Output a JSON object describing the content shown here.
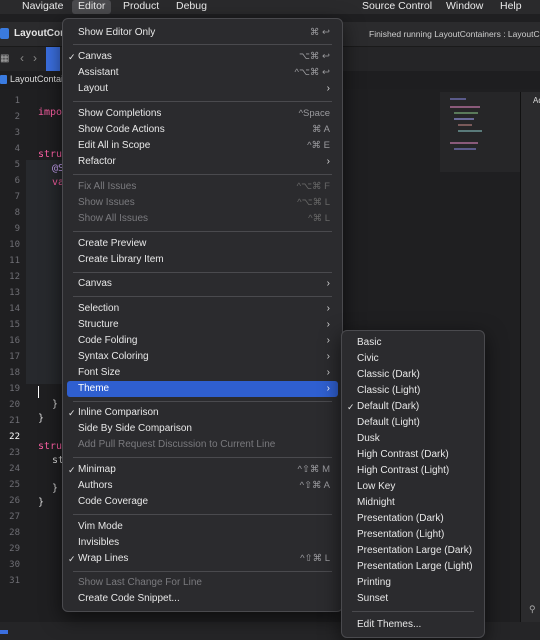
{
  "menubar": {
    "items": [
      "Navigate",
      "Editor",
      "Product",
      "Debug",
      "Source Control",
      "Window",
      "Help"
    ],
    "active": "Editor"
  },
  "window": {
    "project": "LayoutCon",
    "status": "Finished running LayoutContainers : LayoutC"
  },
  "tab": {
    "label": "LayoutContai"
  },
  "right_panel_label": "Ad",
  "editor": {
    "line_numbers": [
      "1",
      "2",
      "3",
      "4",
      "5",
      "6",
      "7",
      "8",
      "9",
      "10",
      "11",
      "12",
      "13",
      "14",
      "15",
      "16",
      "17",
      "18",
      "19",
      "20",
      "21",
      "22",
      "23",
      "24",
      "25",
      "26",
      "27",
      "28",
      "29",
      "30",
      "31"
    ],
    "current_line": "22",
    "fragments": [
      {
        "text": "impo",
        "kw": true
      },
      {
        "text": "stru",
        "kw": true
      },
      {
        "text": "@S",
        "kw": false
      },
      {
        "text": "va",
        "kw": true
      },
      {
        "text": "}",
        "kw": false
      },
      {
        "text": "}",
        "kw": false
      },
      {
        "text": "stru",
        "kw": true
      },
      {
        "text": "st",
        "kw": false
      },
      {
        "text": "}",
        "kw": false
      },
      {
        "text": "}",
        "kw": false
      }
    ]
  },
  "editor_menu": {
    "items": [
      {
        "label": "Show Editor Only",
        "shortcut": "⌘ ↩"
      },
      {
        "sep": true
      },
      {
        "label": "Canvas",
        "shortcut": "⌥⌘ ↩",
        "checked": true
      },
      {
        "label": "Assistant",
        "shortcut": "^⌥⌘ ↩"
      },
      {
        "label": "Layout",
        "submenu": true
      },
      {
        "sep": true
      },
      {
        "label": "Show Completions",
        "shortcut": "^Space"
      },
      {
        "label": "Show Code Actions",
        "shortcut": "⌘ A"
      },
      {
        "label": "Edit All in Scope",
        "shortcut": "^⌘ E"
      },
      {
        "label": "Refactor",
        "submenu": true
      },
      {
        "sep": true
      },
      {
        "label": "Fix All Issues",
        "shortcut": "^⌥⌘ F",
        "disabled": true
      },
      {
        "label": "Show Issues",
        "shortcut": "^⌥⌘ L",
        "disabled": true
      },
      {
        "label": "Show All Issues",
        "shortcut": "^⌘ L",
        "disabled": true
      },
      {
        "sep": true
      },
      {
        "label": "Create Preview"
      },
      {
        "label": "Create Library Item"
      },
      {
        "sep": true
      },
      {
        "label": "Canvas",
        "submenu": true
      },
      {
        "sep": true
      },
      {
        "label": "Selection",
        "submenu": true
      },
      {
        "label": "Structure",
        "submenu": true
      },
      {
        "label": "Code Folding",
        "submenu": true
      },
      {
        "label": "Syntax Coloring",
        "submenu": true
      },
      {
        "label": "Font Size",
        "submenu": true
      },
      {
        "label": "Theme",
        "submenu": true,
        "highlighted": true
      },
      {
        "sep": true
      },
      {
        "label": "Inline Comparison",
        "checked": true
      },
      {
        "label": "Side By Side Comparison"
      },
      {
        "label": "Add Pull Request Discussion to Current Line",
        "disabled": true
      },
      {
        "sep": true
      },
      {
        "label": "Minimap",
        "shortcut": "^⇧⌘ M",
        "checked": true
      },
      {
        "label": "Authors",
        "shortcut": "^⇧⌘ A"
      },
      {
        "label": "Code Coverage"
      },
      {
        "sep": true
      },
      {
        "label": "Vim Mode"
      },
      {
        "label": "Invisibles"
      },
      {
        "label": "Wrap Lines",
        "shortcut": "^⇧⌘ L",
        "checked": true
      },
      {
        "sep": true
      },
      {
        "label": "Show Last Change For Line",
        "disabled": true
      },
      {
        "label": "Create Code Snippet..."
      }
    ]
  },
  "theme_menu": {
    "items": [
      {
        "label": "Basic"
      },
      {
        "label": "Civic"
      },
      {
        "label": "Classic (Dark)"
      },
      {
        "label": "Classic (Light)"
      },
      {
        "label": "Default (Dark)",
        "checked": true
      },
      {
        "label": "Default (Light)"
      },
      {
        "label": "Dusk"
      },
      {
        "label": "High Contrast (Dark)"
      },
      {
        "label": "High Contrast (Light)"
      },
      {
        "label": "Low Key"
      },
      {
        "label": "Midnight"
      },
      {
        "label": "Presentation (Dark)"
      },
      {
        "label": "Presentation (Light)"
      },
      {
        "label": "Presentation Large (Dark)"
      },
      {
        "label": "Presentation Large (Light)"
      },
      {
        "label": "Printing"
      },
      {
        "label": "Sunset"
      },
      {
        "sep": true
      },
      {
        "label": "Edit Themes..."
      }
    ]
  },
  "colors": {
    "highlight": "#2f5fd0",
    "keyword": "#fc5fa3",
    "menu_bg": "#2b2b2e"
  }
}
